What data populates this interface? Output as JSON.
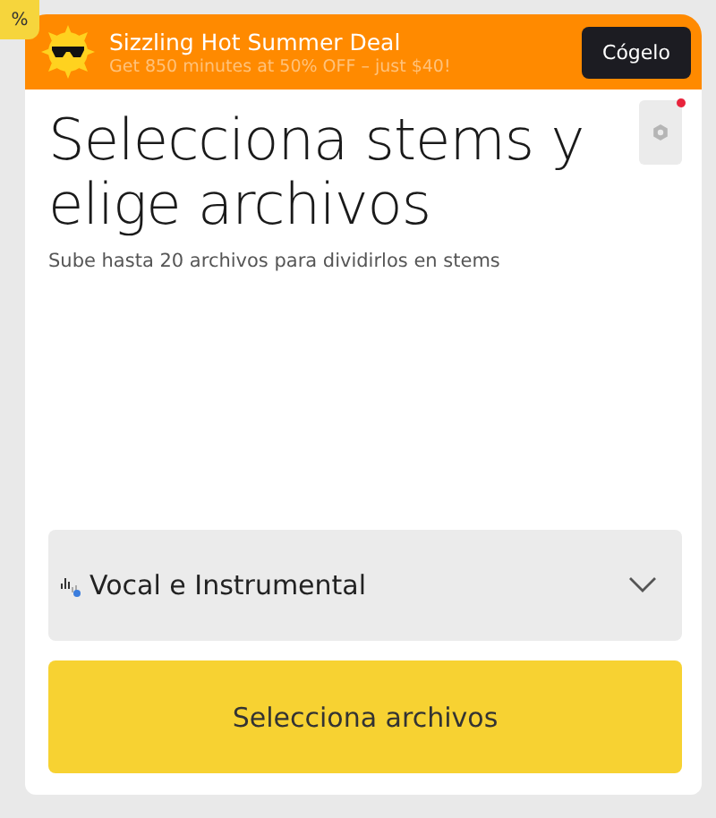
{
  "corner_badge": {
    "text": "%"
  },
  "promo": {
    "title": "Sizzling Hot Summer Deal",
    "subtitle": "Get 850 minutes at 50% OFF – just $40!",
    "button": "Cógelo"
  },
  "panel": {
    "title": "Selecciona stems y elige archivos",
    "subtitle": "Sube hasta 20 archivos para dividirlos en stems",
    "settings": {
      "notification": true
    },
    "stem_select": {
      "value": "Vocal e Instrumental",
      "expanded": false
    },
    "button": "Selecciona archivos"
  }
}
